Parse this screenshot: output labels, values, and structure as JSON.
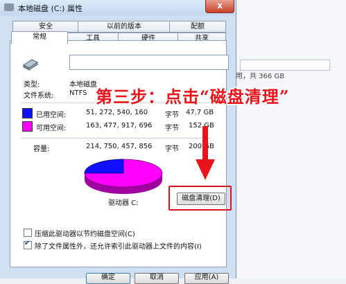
{
  "window": {
    "title": "本地磁盘 (C:) 属性",
    "close_label": "x"
  },
  "tabs_row1": [
    "安全",
    "以前的版本",
    "配额"
  ],
  "tabs_row2": [
    "常规",
    "工具",
    "硬件",
    "共享"
  ],
  "general": {
    "name_value": "",
    "type_label": "类型:",
    "type_value": "本地磁盘",
    "fs_label": "文件系统:",
    "fs_value": "NTFS",
    "used_label": "已用空间:",
    "used_bytes": "51, 272, 540, 160",
    "used_unit": "字节",
    "used_gb": "47.7 GB",
    "free_label": "可用空间:",
    "free_bytes": "163, 477, 917, 696",
    "free_unit": "字节",
    "free_gb": "152 GB",
    "cap_label": "容量:",
    "cap_bytes": "214, 750, 457, 856",
    "cap_unit": "字节",
    "cap_gb": "200 GB",
    "drive_label": "驱动器 C:",
    "cleanup_button": "磁盘清理(D)"
  },
  "checkboxes": [
    {
      "label": "压缩此驱动器以节约磁盘空间(C)",
      "checked": false
    },
    {
      "label": "除了文件属性外，还允许索引此驱动器上文件的内容(I)",
      "checked": true
    }
  ],
  "buttons": {
    "ok": "确定",
    "cancel": "取消",
    "apply": "应用(A)"
  },
  "background": {
    "free_text": "用，共 366 GB"
  },
  "annotation": {
    "text": "第三步：点击“磁盘清理”"
  },
  "colors": {
    "used": "#1010ff",
    "free": "#ff00ff",
    "highlight": "#d9141b"
  },
  "pie": {
    "used_fraction": 0.238
  }
}
